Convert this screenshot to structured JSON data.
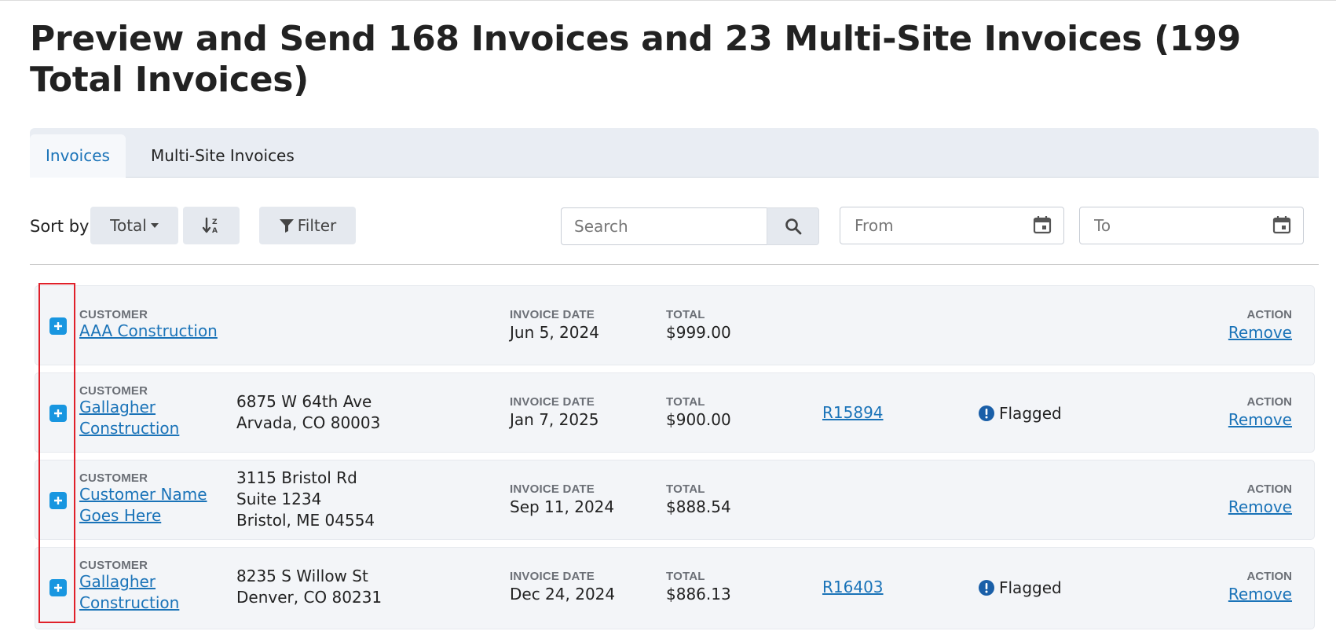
{
  "page": {
    "title": "Preview and Send 168 Invoices and 23 Multi-Site Invoices (199 Total Invoices)"
  },
  "tabs": [
    {
      "label": "Invoices",
      "active": true
    },
    {
      "label": "Multi-Site Invoices",
      "active": false
    }
  ],
  "toolbar": {
    "sort_label": "Sort by",
    "sort_value": "Total",
    "filter_label": "Filter",
    "search_placeholder": "Search",
    "from_placeholder": "From",
    "to_placeholder": "To"
  },
  "labels": {
    "customer": "CUSTOMER",
    "invoice_date": "INVOICE DATE",
    "total": "TOTAL",
    "action": "ACTION",
    "remove": "Remove"
  },
  "rows": [
    {
      "customer_line1": "AAA Construction",
      "customer_line2": "",
      "address": [],
      "invoice_date": "Jun 5, 2024",
      "total": "$999.00",
      "ref": "",
      "flag": ""
    },
    {
      "customer_line1": "Gallagher",
      "customer_line2": "Construction",
      "address": [
        "6875 W 64th Ave",
        "Arvada, CO 80003"
      ],
      "invoice_date": "Jan 7, 2025",
      "total": "$900.00",
      "ref": "R15894",
      "flag": "Flagged"
    },
    {
      "customer_line1": "Customer Name",
      "customer_line2": "Goes Here",
      "address": [
        "3115 Bristol Rd",
        "Suite 1234",
        "Bristol, ME 04554"
      ],
      "invoice_date": "Sep 11, 2024",
      "total": "$888.54",
      "ref": "",
      "flag": ""
    },
    {
      "customer_line1": "Gallagher",
      "customer_line2": "Construction",
      "address": [
        "8235 S Willow St",
        "Denver, CO 80231"
      ],
      "invoice_date": "Dec 24, 2024",
      "total": "$886.13",
      "ref": "R16403",
      "flag": "Flagged"
    }
  ],
  "colors": {
    "accent": "#1a73b8",
    "expand_button": "#1896e0",
    "highlight": "#e0202a"
  },
  "icons": [
    "plus-icon",
    "search-icon",
    "calendar-icon",
    "filter-icon",
    "sort-descending-icon",
    "caret-down-icon",
    "exclamation-circle-icon"
  ]
}
